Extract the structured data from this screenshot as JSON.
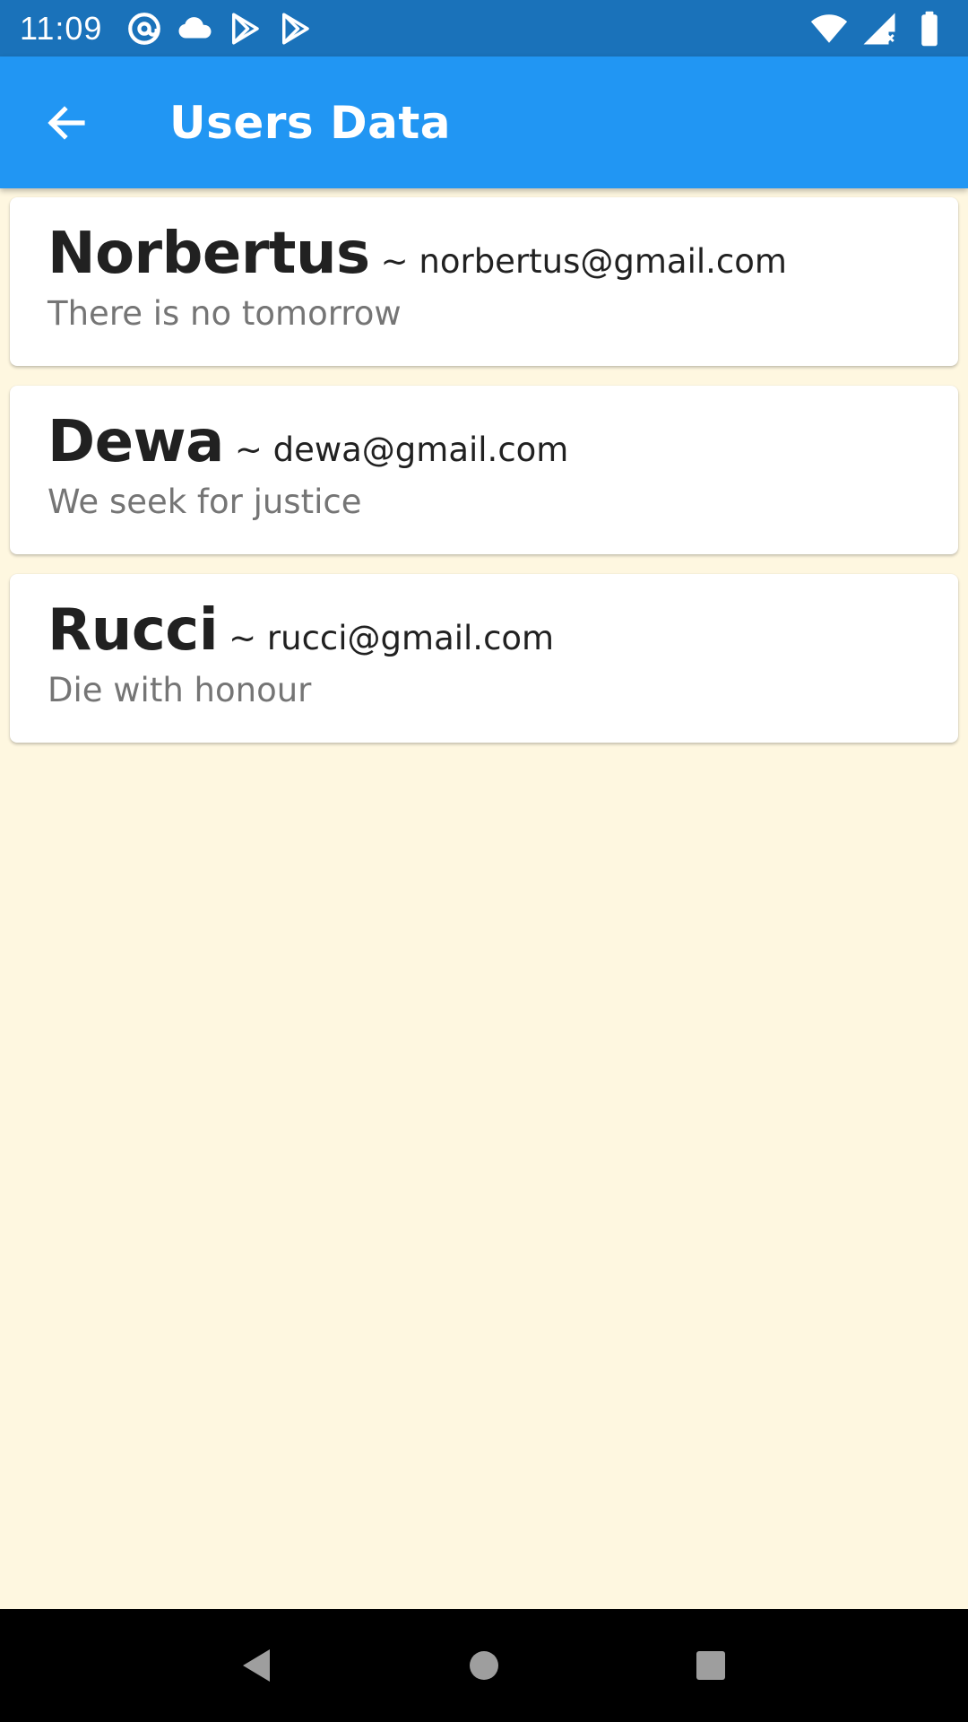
{
  "status_bar": {
    "time": "11:09",
    "left_icons": [
      "at-sign-icon",
      "cloud-icon",
      "play-store-icon",
      "play-store-icon"
    ],
    "right_icons": [
      "wifi-icon",
      "signal-icon",
      "battery-icon"
    ]
  },
  "app_bar": {
    "back_icon": "arrow-back-icon",
    "title": "Users Data"
  },
  "users": [
    {
      "name": "Norbertus",
      "email": "~ norbertus@gmail.com",
      "motto": "There is no tomorrow"
    },
    {
      "name": "Dewa",
      "email": "~ dewa@gmail.com",
      "motto": "We seek for justice"
    },
    {
      "name": "Rucci",
      "email": "~ rucci@gmail.com",
      "motto": "Die with honour"
    }
  ],
  "nav_bar": {
    "buttons": [
      "back-triangle-icon",
      "home-circle-icon",
      "recents-square-icon"
    ]
  },
  "colors": {
    "status_bar": "#1a72ba",
    "app_bar": "#2196f3",
    "background": "#fef7e0",
    "card": "#ffffff"
  }
}
